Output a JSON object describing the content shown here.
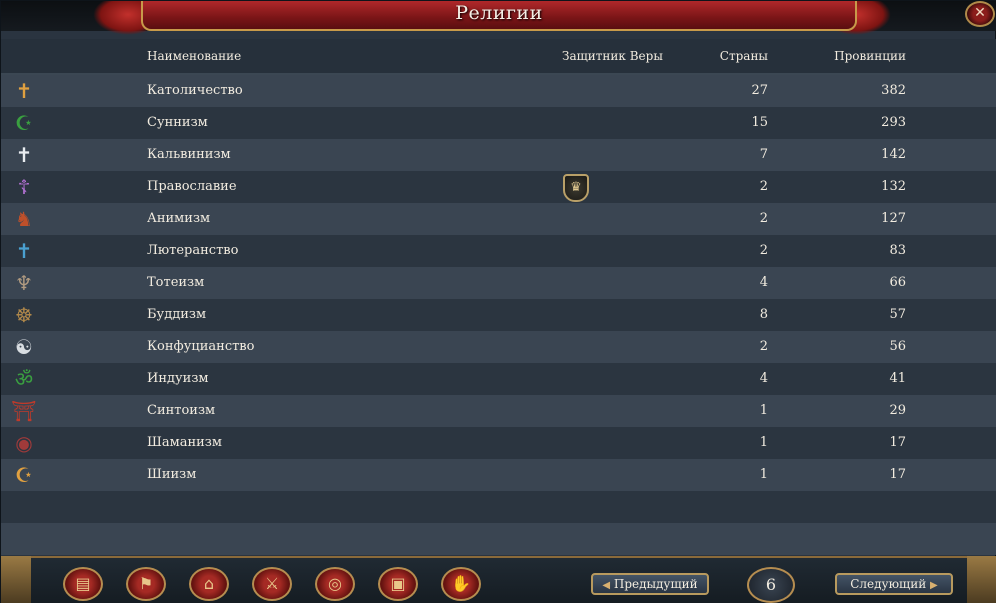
{
  "window": {
    "title": "Религии"
  },
  "columns": {
    "name": "Наименование",
    "defender": "Защитник Веры",
    "countries": "Страны",
    "provinces": "Провинции"
  },
  "religions": [
    {
      "icon": "catholic-cross-icon",
      "glyph": "✝",
      "color": "#e0a040",
      "name": "Католичество",
      "countries": "27",
      "provinces": "382",
      "defender": false
    },
    {
      "icon": "sunni-crescent-icon",
      "glyph": "☪",
      "color": "#3aa040",
      "name": "Суннизм",
      "countries": "15",
      "provinces": "293",
      "defender": false
    },
    {
      "icon": "calvinist-cross-icon",
      "glyph": "✝",
      "color": "#e8ecf0",
      "name": "Кальвинизм",
      "countries": "7",
      "provinces": "142",
      "defender": false
    },
    {
      "icon": "orthodox-cross-icon",
      "glyph": "☦",
      "color": "#b070d0",
      "name": "Православие",
      "countries": "2",
      "provinces": "132",
      "defender": true
    },
    {
      "icon": "animism-beast-icon",
      "glyph": "♞",
      "color": "#c0502a",
      "name": "Анимизм",
      "countries": "2",
      "provinces": "127",
      "defender": false
    },
    {
      "icon": "lutheran-cross-icon",
      "glyph": "✝",
      "color": "#4aa0d0",
      "name": "Лютеранство",
      "countries": "2",
      "provinces": "83",
      "defender": false
    },
    {
      "icon": "totem-pole-icon",
      "glyph": "♆",
      "color": "#b09a80",
      "name": "Тотеизм",
      "countries": "4",
      "provinces": "66",
      "defender": false
    },
    {
      "icon": "dharma-wheel-icon",
      "glyph": "☸",
      "color": "#b0884a",
      "name": "Буддизм",
      "countries": "8",
      "provinces": "57",
      "defender": false
    },
    {
      "icon": "yin-yang-icon",
      "glyph": "☯",
      "color": "#d8dde2",
      "name": "Конфуцианство",
      "countries": "2",
      "provinces": "56",
      "defender": false
    },
    {
      "icon": "om-icon",
      "glyph": "ॐ",
      "color": "#3aa040",
      "name": "Индуизм",
      "countries": "4",
      "provinces": "41",
      "defender": false
    },
    {
      "icon": "torii-gate-icon",
      "glyph": "⛩",
      "color": "#c03a2a",
      "name": "Синтоизм",
      "countries": "1",
      "provinces": "29",
      "defender": false
    },
    {
      "icon": "shaman-drum-icon",
      "glyph": "◉",
      "color": "#a03a3a",
      "name": "Шаманизм",
      "countries": "1",
      "provinces": "17",
      "defender": false
    },
    {
      "icon": "shia-crescent-icon",
      "glyph": "☪",
      "color": "#e0a040",
      "name": "Шиизм",
      "countries": "1",
      "provinces": "17",
      "defender": false
    }
  ],
  "toolbar": [
    {
      "icon": "ledger-scroll-icon",
      "glyph": "▤"
    },
    {
      "icon": "green-flag-icon",
      "glyph": "⚑"
    },
    {
      "icon": "buildings-icon",
      "glyph": "⌂"
    },
    {
      "icon": "crossed-swords-icon",
      "glyph": "⚔"
    },
    {
      "icon": "coins-icon",
      "glyph": "◎"
    },
    {
      "icon": "trade-goods-icon",
      "glyph": "▣"
    },
    {
      "icon": "handshake-icon",
      "glyph": "✋"
    }
  ],
  "pagination": {
    "prev_label": "Предыдущий",
    "next_label": "Следующий",
    "page": "6"
  }
}
